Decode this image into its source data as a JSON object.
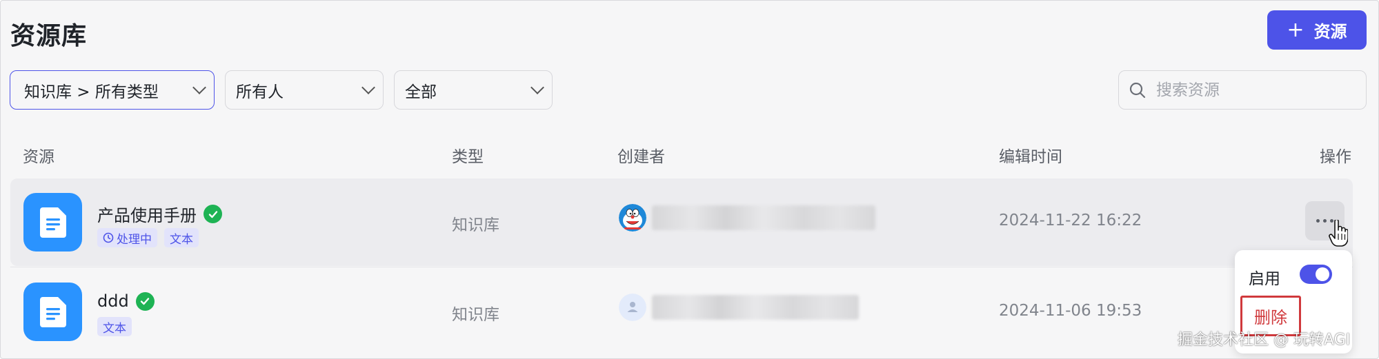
{
  "page": {
    "title": "资源库"
  },
  "header": {
    "add_button_label": "资源",
    "add_icon": "plus-icon"
  },
  "filters": {
    "knowledge_type": "知识库 > 所有类型",
    "owner": "所有人",
    "status": "全部"
  },
  "search": {
    "placeholder": "搜索资源",
    "icon": "search-icon"
  },
  "table": {
    "columns": {
      "resource": "资源",
      "type": "类型",
      "creator": "创建者",
      "edited_at": "编辑时间",
      "actions": "操作"
    },
    "rows": [
      {
        "name": "产品使用手册",
        "tags": [
          "处理中",
          "文本"
        ],
        "type": "知识库",
        "creator_avatar": "doraemon-avatar",
        "edited_at": "2024-11-22 16:22"
      },
      {
        "name": "ddd",
        "tags": [
          "文本"
        ],
        "type": "知识库",
        "creator_avatar": "default-user-avatar",
        "edited_at": "2024-11-06 19:53"
      }
    ]
  },
  "action_menu": {
    "enable_label": "启用",
    "enabled": true,
    "delete_label": "删除"
  },
  "watermark": "掘金技术社区 @ 玩转AGI",
  "colors": {
    "accent": "#4d53e8",
    "file_icon": "#2a93ff",
    "success": "#1eb354",
    "danger": "#d0393c"
  }
}
